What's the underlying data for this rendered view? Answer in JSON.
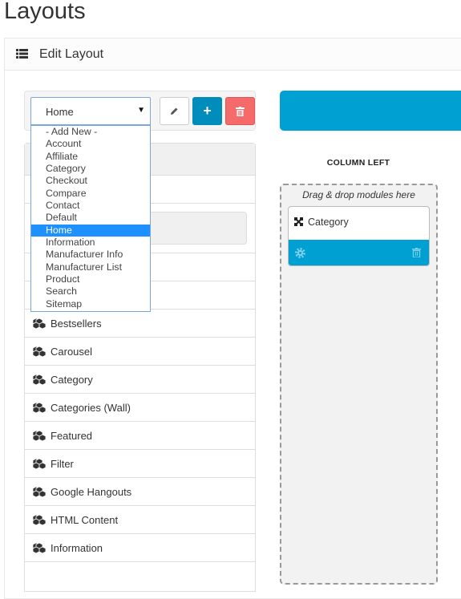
{
  "page": {
    "title": "Layouts"
  },
  "panel": {
    "heading": "Edit Layout",
    "icon": "list-icon"
  },
  "layout_select": {
    "value": "Home",
    "options": [
      "- Add New -",
      "Account",
      "Affiliate",
      "Category",
      "Checkout",
      "Compare",
      "Contact",
      "Default",
      "Home",
      "Information",
      "Manufacturer Info",
      "Manufacturer List",
      "Product",
      "Search",
      "Sitemap"
    ],
    "highlighted": "Home"
  },
  "buttons": {
    "edit": "pencil-icon",
    "add": "plus-icon",
    "delete": "trash-icon"
  },
  "modules": [
    "Bestsellers",
    "Carousel",
    "Category",
    "Categories (Wall)",
    "Featured",
    "Filter",
    "Google Hangouts",
    "HTML Content",
    "Information"
  ],
  "column_left": {
    "label": "COLUMN LEFT",
    "hint": "Drag & drop modules here",
    "modules": [
      {
        "name": "Category"
      }
    ]
  },
  "colors": {
    "primary": "#00a0d2",
    "danger": "#f56b6b",
    "highlight": "#1e90ff"
  }
}
